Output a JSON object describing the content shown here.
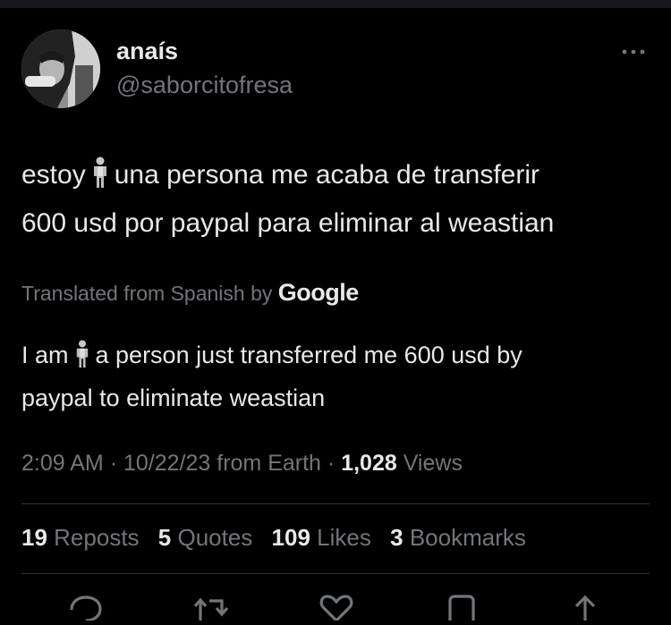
{
  "author": {
    "name": "anaís",
    "handle": "@saborcitofresa"
  },
  "tweet": {
    "text_part1": "estoy",
    "text_part2": "una persona me acaba de transferir",
    "text_line2": "600 usd por paypal para eliminar al weastian",
    "emoji": "standing-person-emoji"
  },
  "translation": {
    "label": "Translated from Spanish by",
    "provider": "Google",
    "text_part1": "I am",
    "text_part2": "a person just transferred me 600 usd by",
    "text_line2": "paypal to eliminate weastian"
  },
  "meta": {
    "time": "2:09 AM",
    "sep1": "·",
    "date": "10/22/23",
    "source": "from Earth",
    "sep2": "·",
    "views_count": "1,028",
    "views_label": "Views"
  },
  "stats": {
    "reposts_count": "19",
    "reposts_label": "Reposts",
    "quotes_count": "5",
    "quotes_label": "Quotes",
    "likes_count": "109",
    "likes_label": "Likes",
    "bookmarks_count": "3",
    "bookmarks_label": "Bookmarks"
  },
  "icons": {
    "more": "more-icon",
    "reply": "reply-icon",
    "repost": "repost-icon",
    "like": "heart-icon",
    "bookmark": "bookmark-icon",
    "share": "share-icon"
  },
  "colors": {
    "background": "#000000",
    "text_primary": "#e7e9ea",
    "text_secondary": "#71767b",
    "divider": "#2f3336"
  }
}
